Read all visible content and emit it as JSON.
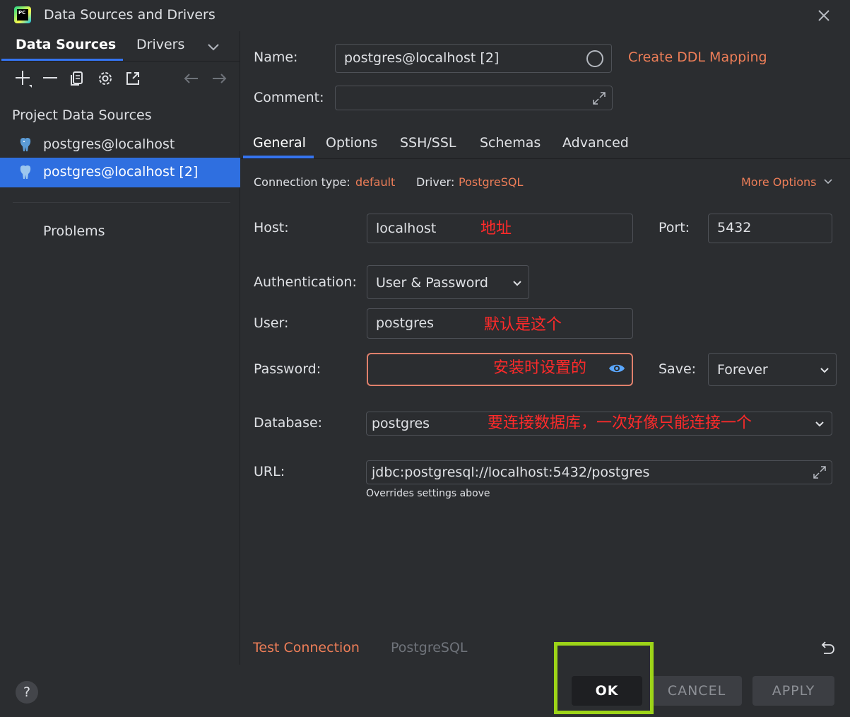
{
  "window": {
    "title": "Data Sources and Drivers",
    "app_logo_text": "PC"
  },
  "left": {
    "tabs": [
      "Data Sources",
      "Drivers"
    ],
    "section_title": "Project Data Sources",
    "items": [
      {
        "label": "postgres@localhost"
      },
      {
        "label": "postgres@localhost [2]"
      }
    ],
    "problems": "Problems"
  },
  "form": {
    "name_label": "Name:",
    "name_value": "postgres@localhost [2]",
    "ddl_link": "Create DDL Mapping",
    "comment_label": "Comment:",
    "tabs": [
      "General",
      "Options",
      "SSH/SSL",
      "Schemas",
      "Advanced"
    ],
    "conn_type_label": "Connection type:",
    "conn_type_value": "default",
    "driver_label": "Driver:",
    "driver_value": "PostgreSQL",
    "more_options": "More Options",
    "host_label": "Host:",
    "host_value": "localhost",
    "port_label": "Port:",
    "port_value": "5432",
    "auth_label": "Authentication:",
    "auth_value": "User & Password",
    "user_label": "User:",
    "user_value": "postgres",
    "password_label": "Password:",
    "save_label": "Save:",
    "save_value": "Forever",
    "database_label": "Database:",
    "database_value": "postgres",
    "url_label": "URL:",
    "url_value": "jdbc:postgresql://localhost:5432/postgres",
    "url_note": "Overrides settings above",
    "test_connection": "Test Connection",
    "driver_ref": "PostgreSQL"
  },
  "annotations": {
    "host": "地址",
    "user": "默认是这个",
    "password": "安装时设置的",
    "database": "要连接数据库，一次好像只能连接一个"
  },
  "footer": {
    "help": "?",
    "ok": "OK",
    "cancel": "CANCEL",
    "apply": "APPLY"
  },
  "colors": {
    "accent": "#3574f0",
    "link": "#ee7e58",
    "annotation": "#ff2a2a",
    "highlight": "#9dd418"
  }
}
